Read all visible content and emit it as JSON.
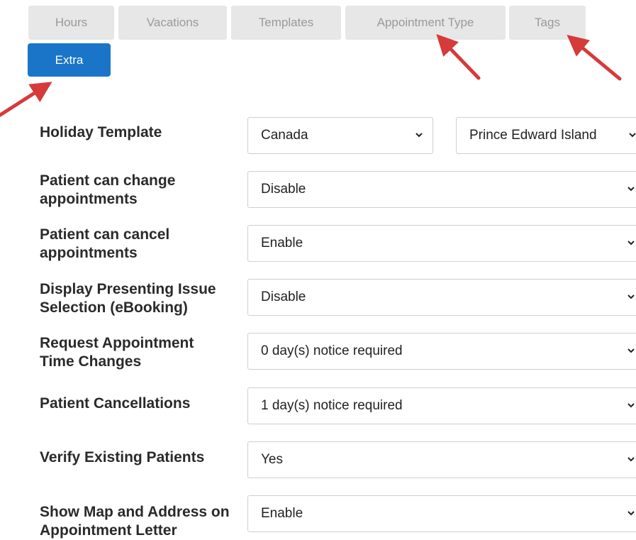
{
  "tabs": {
    "hours": "Hours",
    "vacations": "Vacations",
    "templates": "Templates",
    "appointment_type": "Appointment Type",
    "tags": "Tags",
    "extra": "Extra"
  },
  "accent_color": "#1a75c9",
  "annotation_color": "#d63a3a",
  "settings": {
    "holiday_template": {
      "label": "Holiday Template",
      "country": "Canada",
      "province": "Prince Edward Island"
    },
    "patient_change": {
      "label": "Patient can change appointments",
      "value": "Disable"
    },
    "patient_cancel": {
      "label": "Patient can cancel appointments",
      "value": "Enable"
    },
    "presenting_issue": {
      "label": "Display Presenting Issue Selection (eBooking)",
      "value": "Disable"
    },
    "request_time_changes": {
      "label": "Request Appointment Time Changes",
      "value": "0 day(s) notice required"
    },
    "patient_cancellations": {
      "label": "Patient Cancellations",
      "value": "1 day(s) notice required"
    },
    "verify_patients": {
      "label": "Verify Existing Patients",
      "value": "Yes"
    },
    "show_map": {
      "label": "Show Map and Address on Appointment Letter",
      "value": "Enable"
    }
  },
  "icons": {
    "dropdown": "chevron-down-icon",
    "annotation": "red-arrow-icon"
  }
}
